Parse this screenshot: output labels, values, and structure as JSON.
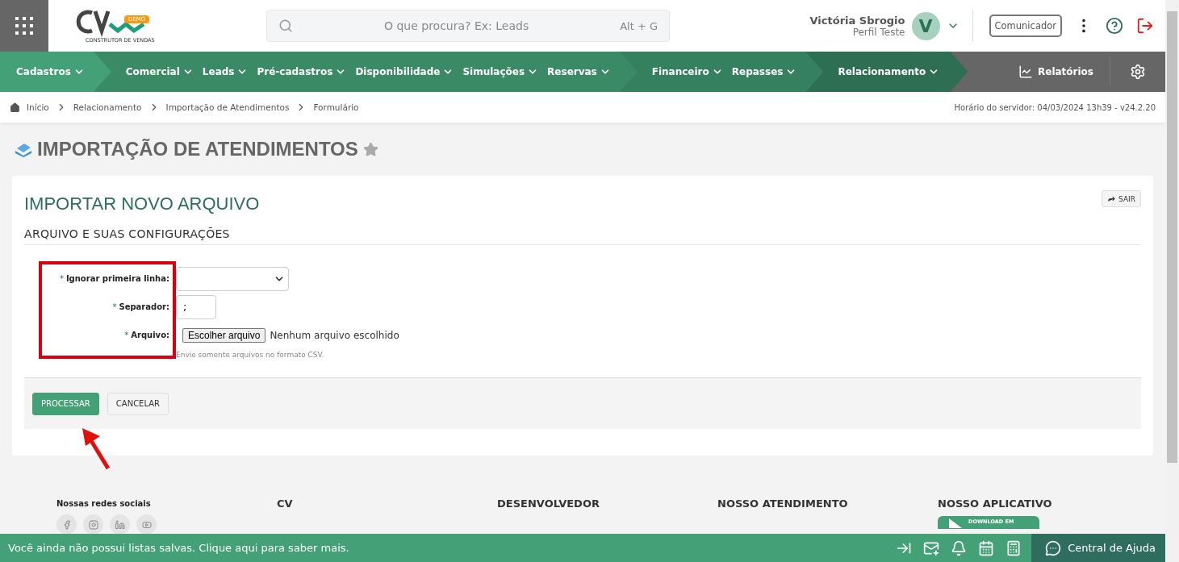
{
  "header": {
    "search": {
      "placeholder": "O que procura? Ex: Leads",
      "shortcut": "Alt + G"
    },
    "logo": {
      "badge": "DEMO",
      "tagline": "CONSTRUTOR DE VENDAS"
    },
    "user": {
      "name": "Victória Sbrogio",
      "profile": "Perfil Teste",
      "initial": "V"
    },
    "communicator": "Comunicador"
  },
  "nav": {
    "groups": [
      {
        "color": "#43a077",
        "items": [
          "Cadastros"
        ]
      },
      {
        "color": "#3b8a66",
        "items": [
          "Comercial",
          "Leads",
          "Pré-cadastros",
          "Disponibilidade",
          "Simulações",
          "Reservas"
        ]
      },
      {
        "color": "#35805e",
        "items": [
          "Financeiro",
          "Repasses"
        ]
      },
      {
        "color": "#2e6e52",
        "items": [
          "Relacionamento"
        ]
      }
    ],
    "reports": "Relatórios"
  },
  "breadcrumb": [
    "Início",
    "Relacionamento",
    "Importação de Atendimentos",
    "Formulário"
  ],
  "server_time": "Horário do servidor: 04/03/2024 13h39 - v24.2.20",
  "page_title": "IMPORTAÇÃO DE ATENDIMENTOS",
  "card": {
    "title": "IMPORTAR NOVO ARQUIVO",
    "exit": "SAIR",
    "section": "ARQUIVO E SUAS CONFIGURAÇÕES",
    "fields": [
      {
        "kind": "select",
        "label": "Ignorar primeira linha:",
        "required": "*"
      },
      {
        "kind": "text",
        "label": "Separador:",
        "required": "*",
        "value": ";"
      },
      {
        "kind": "file",
        "label": "Arquivo:",
        "required": "*",
        "button": "Escolher arquivo",
        "status": "Nenhum arquivo escolhido"
      }
    ],
    "hint": "Envie somente arquivos no formato CSV.",
    "actions": [
      {
        "label": "PROCESSAR",
        "kind": "primary"
      },
      {
        "label": "CANCELAR",
        "kind": "secondary"
      }
    ]
  },
  "footer": {
    "social_title": "Nossas redes sociais",
    "columns": [
      {
        "title": "CV"
      },
      {
        "title": "DESENVOLVEDOR"
      },
      {
        "title": "NOSSO ATENDIMENTO"
      },
      {
        "title": "NOSSO APLICATIVO",
        "link": "DOWNLOAD EM",
        "kind": "store"
      }
    ]
  },
  "bottom_bar": {
    "message": "Você ainda não possui listas salvas. Clique aqui para saber mais.",
    "help": "Central de Ajuda"
  }
}
